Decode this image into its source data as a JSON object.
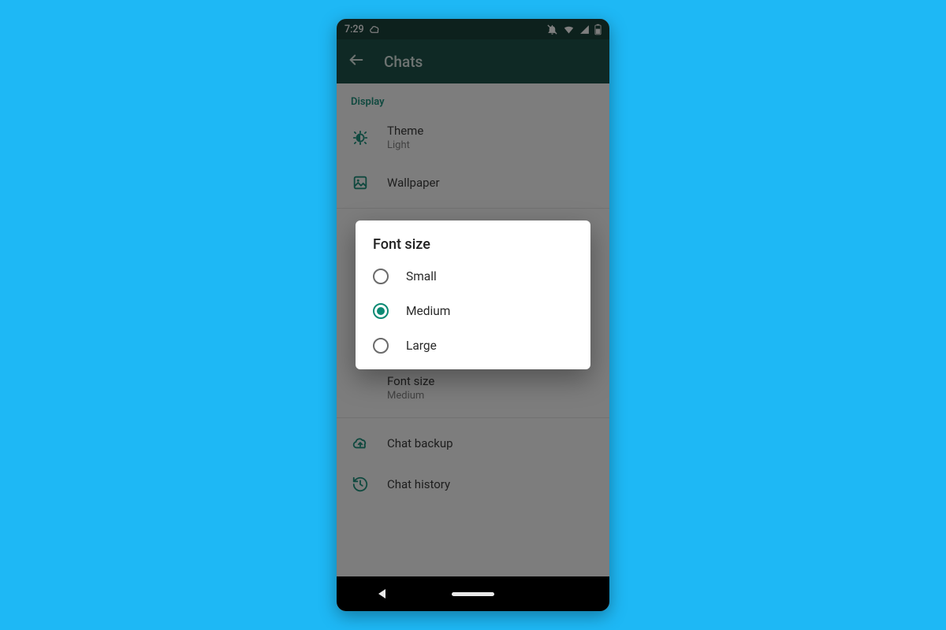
{
  "statusbar": {
    "time": "7:29"
  },
  "appbar": {
    "title": "Chats"
  },
  "sections": {
    "display": {
      "header": "Display",
      "theme": {
        "label": "Theme",
        "value": "Light"
      },
      "wallpaper": {
        "label": "Wallpaper"
      }
    },
    "chat_settings": {
      "font_size": {
        "label": "Font size",
        "value": "Medium"
      }
    },
    "other": {
      "chat_backup": {
        "label": "Chat backup"
      },
      "chat_history": {
        "label": "Chat history"
      }
    }
  },
  "dialog": {
    "title": "Font size",
    "selected": "medium",
    "options": {
      "small": "Small",
      "medium": "Medium",
      "large": "Large"
    }
  },
  "colors": {
    "accent": "#0c8a74",
    "appbar": "#0b443b",
    "bg": "#1eb8f5"
  }
}
